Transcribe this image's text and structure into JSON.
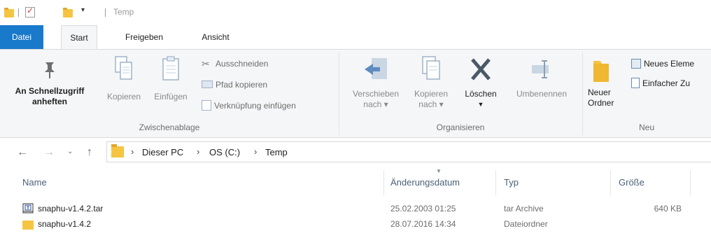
{
  "window": {
    "title": "Temp"
  },
  "tabs": {
    "file": "Datei",
    "start": "Start",
    "share": "Freigeben",
    "view": "Ansicht"
  },
  "ribbon": {
    "clipboard": {
      "pin_line1": "An Schnellzugriff",
      "pin_line2": "anheften",
      "copy": "Kopieren",
      "paste": "Einfügen",
      "cut": "Ausschneiden",
      "copy_path": "Pfad kopieren",
      "paste_shortcut": "Verknüpfung einfügen",
      "label": "Zwischenablage"
    },
    "organize": {
      "move_line1": "Verschieben",
      "move_line2": "nach",
      "copyto_line1": "Kopieren",
      "copyto_line2": "nach",
      "delete": "Löschen",
      "rename": "Umbenennen",
      "label": "Organisieren"
    },
    "new": {
      "folder_line1": "Neuer",
      "folder_line2": "Ordner",
      "new_item": "Neues Eleme",
      "easy_access": "Einfacher Zu",
      "label": "Neu"
    }
  },
  "address": {
    "crumbs": [
      "Dieser PC",
      "OS (C:)",
      "Temp"
    ]
  },
  "columns": {
    "name": "Name",
    "date": "Änderungsdatum",
    "type": "Typ",
    "size": "Größe"
  },
  "files": [
    {
      "name": "snaphu-v1.4.2.tar",
      "date": "25.02.2003 01:25",
      "type": "tar Archive",
      "size": "640 KB",
      "icon": "archive-file-icon"
    },
    {
      "name": "snaphu-v1.4.2",
      "date": "28.07.2016 14:34",
      "type": "Dateiordner",
      "size": "",
      "icon": "folder-icon"
    }
  ],
  "colors": {
    "accent": "#1979ca",
    "folder": "#f5c542",
    "ribbon_bg": "#f5f6f7"
  }
}
